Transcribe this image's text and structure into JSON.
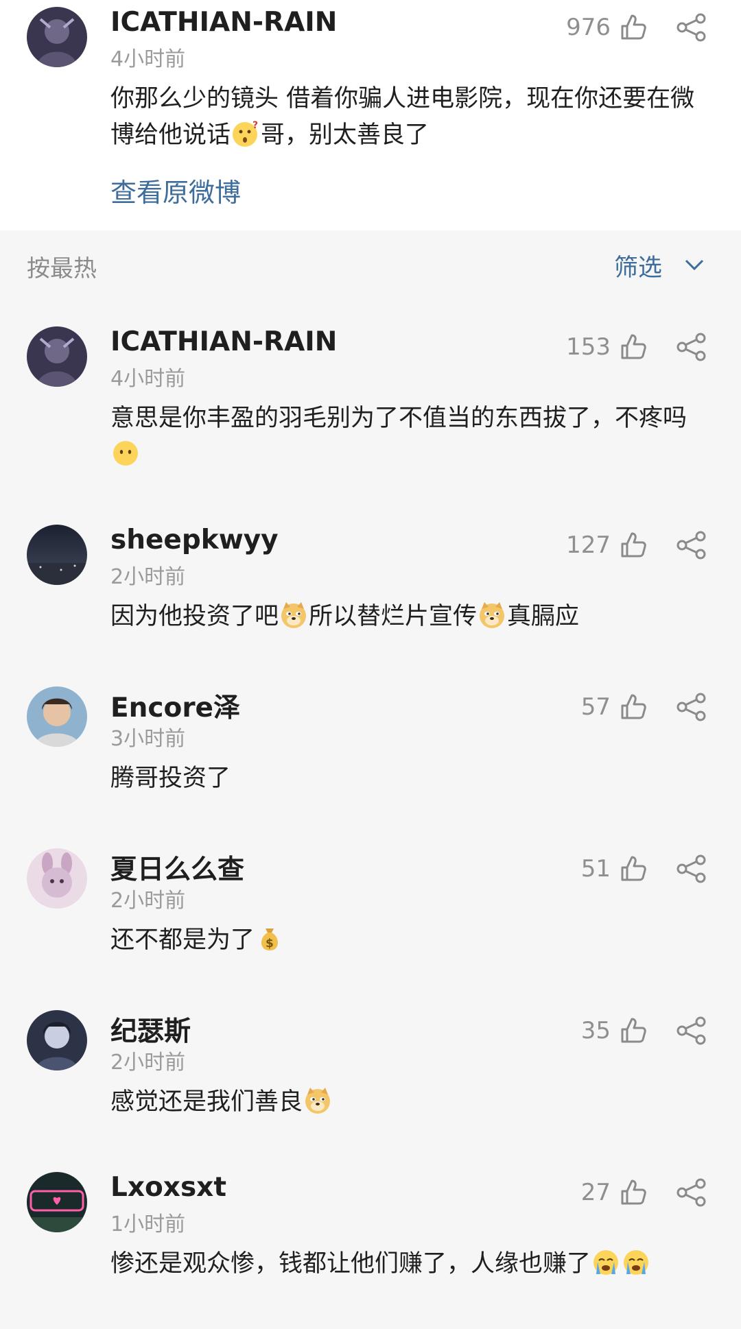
{
  "root_comment": {
    "username": "ICATHIAN-RAIN",
    "time": "4小时前",
    "likes": "976",
    "text_before": "你那么少的镜头 借着你骗人进电影院，现在你还要在微博给他说话",
    "text_after": "哥，别太善良了",
    "emoji": "thinking-face-emoji",
    "view_original": "查看原微博"
  },
  "sort_bar": {
    "sort_label": "按最热",
    "filter_label": "筛选"
  },
  "replies": [
    {
      "username": "ICATHIAN-RAIN",
      "time": "4小时前",
      "likes": "153",
      "parts": [
        "意思是你丰盈的羽毛别为了不值当的东西拔了，不疼吗"
      ],
      "emojis": [
        "speechless-face-emoji"
      ]
    },
    {
      "username": "sheepkwyy",
      "time": "2小时前",
      "likes": "127",
      "parts": [
        "因为他投资了吧",
        "所以替烂片宣传",
        "真膈应"
      ],
      "emojis": [
        "doge-emoji",
        "doge-emoji"
      ]
    },
    {
      "username": "Encore泽",
      "time": "3小时前",
      "likes": "57",
      "parts": [
        "腾哥投资了"
      ],
      "emojis": []
    },
    {
      "username": "夏日么么查",
      "time": "2小时前",
      "likes": "51",
      "parts": [
        "还不都是为了"
      ],
      "emojis": [
        "money-bag-emoji"
      ]
    },
    {
      "username": "纪瑟斯",
      "time": "2小时前",
      "likes": "35",
      "parts": [
        "感觉还是我们善良"
      ],
      "emojis": [
        "doge-emoji"
      ]
    },
    {
      "username": "Lxoxsxt",
      "time": "1小时前",
      "likes": "27",
      "parts": [
        "惨还是观众惨，钱都让他们赚了，人缘也赚了"
      ],
      "emojis": [
        "crying-face-emoji",
        "crying-face-emoji"
      ]
    }
  ],
  "colors": {
    "link_blue": "#3e6d9c",
    "background": "#f6f6f7",
    "card": "#ffffff"
  }
}
